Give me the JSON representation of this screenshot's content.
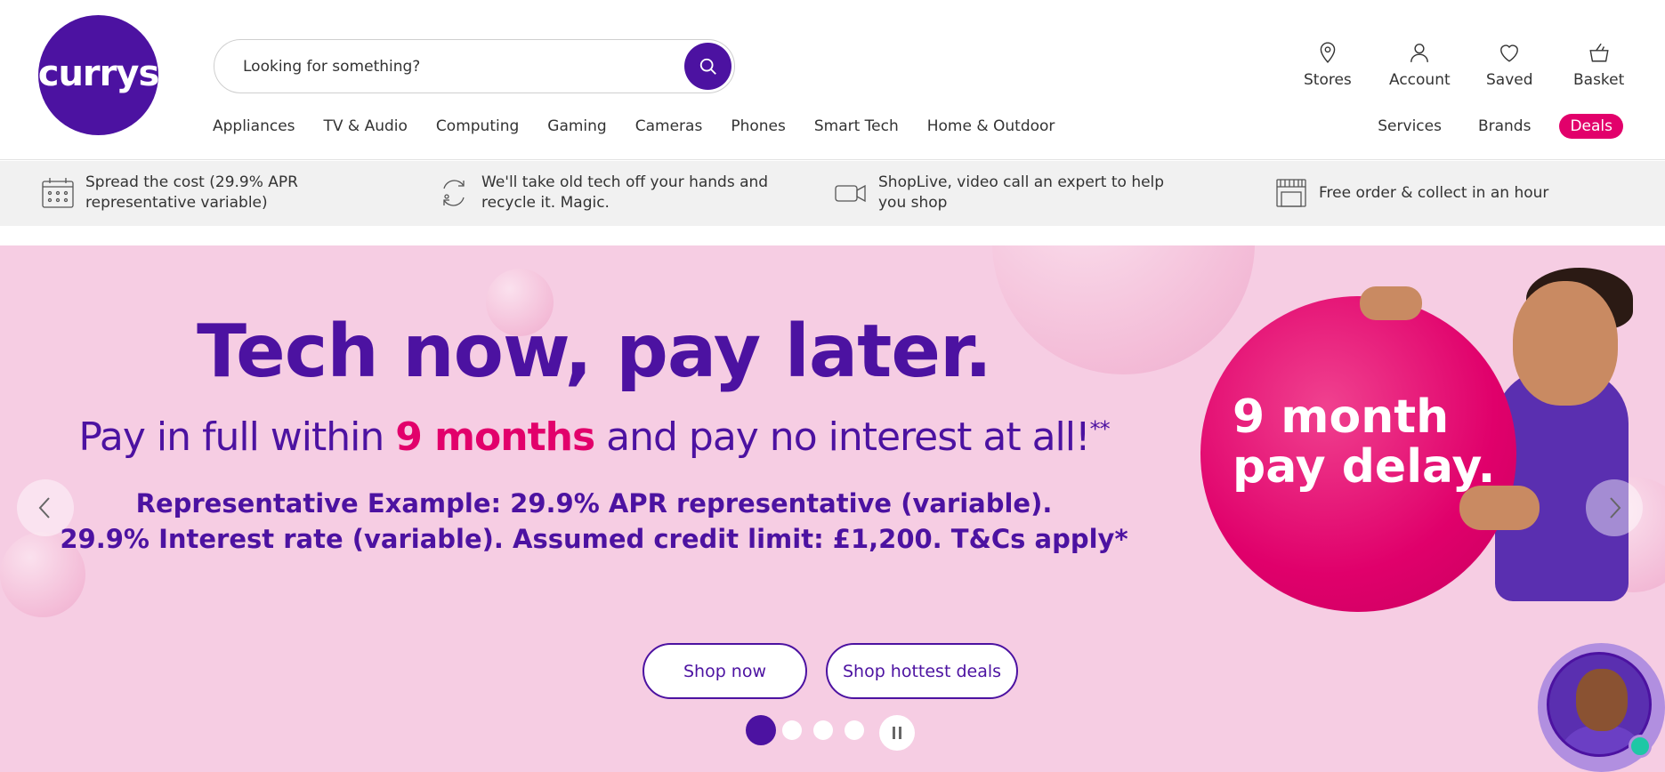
{
  "brand": {
    "logo_text": "currys",
    "primary": "#4c12a1",
    "accent": "#e2006b"
  },
  "search": {
    "placeholder": "Looking for something?"
  },
  "utility_nav": [
    {
      "label": "Stores",
      "icon": "location-pin-icon"
    },
    {
      "label": "Account",
      "icon": "user-icon"
    },
    {
      "label": "Saved",
      "icon": "heart-icon"
    },
    {
      "label": "Basket",
      "icon": "basket-icon"
    }
  ],
  "main_nav": [
    "Appliances",
    "TV & Audio",
    "Computing",
    "Gaming",
    "Cameras",
    "Phones",
    "Smart Tech",
    "Home & Outdoor"
  ],
  "right_nav": {
    "services": "Services",
    "brands": "Brands",
    "deals": "Deals"
  },
  "usp": [
    {
      "line1": "Spread the cost (29.9% APR",
      "line2": "representative variable)",
      "icon": "calendar-icon"
    },
    {
      "line1": "We'll take old tech off your hands and",
      "line2": "recycle it. Magic.",
      "icon": "recycle-icon"
    },
    {
      "line1": "ShopLive, video call an expert to help",
      "line2": "you shop",
      "icon": "video-camera-icon"
    },
    {
      "line1": "Free order & collect in an hour",
      "line2": "",
      "icon": "store-icon"
    }
  ],
  "hero": {
    "headline": "Tech now, pay later.",
    "sub_before": "Pay in full within ",
    "sub_highlight": "9 months",
    "sub_after": " and pay no interest at all!",
    "sub_sup": "**",
    "rep_line1": "Representative Example: 29.9% APR representative (variable).",
    "rep_line2": "29.9% Interest rate (variable). Assumed credit limit: £1,200. T&Cs apply*",
    "ball_line1": "9 month",
    "ball_line2": "pay delay.",
    "cta_primary": "Shop now",
    "cta_secondary": "Shop hottest deals",
    "slides_total": 4,
    "active_slide": 1
  }
}
